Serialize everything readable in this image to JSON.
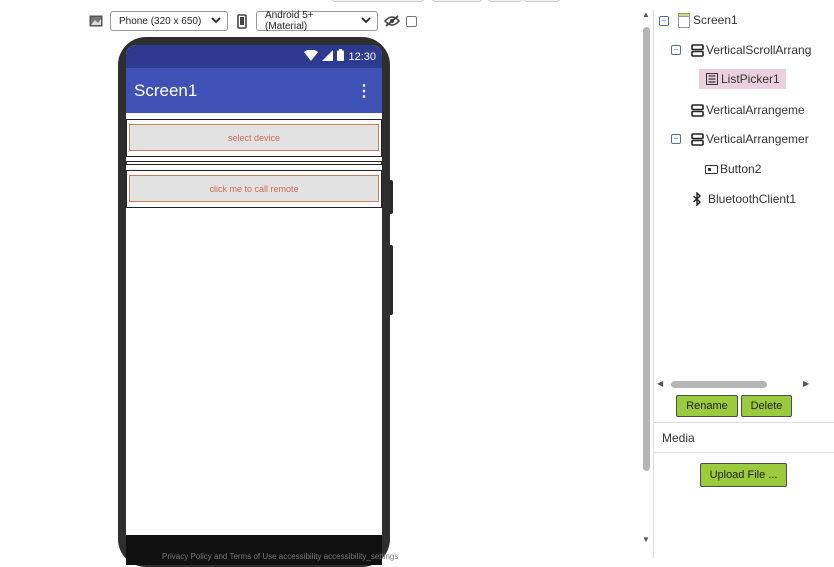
{
  "toolbar": {
    "device_select": "Phone (320 x 650)",
    "theme_select": "Android 5+ (Material)"
  },
  "phone": {
    "status_time": "12:30",
    "app_title": "Screen1",
    "components": {
      "listpicker_label": "select device",
      "button_label": "click me to call remote"
    }
  },
  "tree": {
    "screen": "Screen1",
    "vscroll_arrangement": "VerticalScrollArrang",
    "listpicker": "ListPicker1",
    "varr1": "VerticalArrangeme",
    "varr2": "VerticalArrangemer",
    "button2": "Button2",
    "bluetooth": "BluetoothClient1"
  },
  "actions": {
    "rename": "Rename",
    "delete": "Delete"
  },
  "media": {
    "title": "Media",
    "upload": "Upload File ..."
  },
  "footer": "Privacy Policy and Terms of Use   accessibility  accessibility_settings"
}
